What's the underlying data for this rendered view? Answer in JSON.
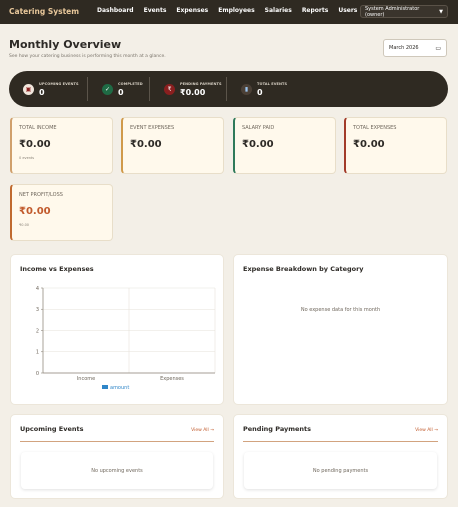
{
  "app": {
    "brand": "Catering System"
  },
  "nav": {
    "links": [
      "Dashboard",
      "Events",
      "Expenses",
      "Employees",
      "Salaries",
      "Reports",
      "Users"
    ],
    "role_select": "System Administrator (owner)"
  },
  "header": {
    "title": "Monthly Overview",
    "subtitle": "See how your catering business is performing this month at a glance.",
    "month": "March 2026"
  },
  "stats": [
    {
      "label": "UPCOMING EVENTS",
      "value": "0",
      "icon": "calendar-icon",
      "color": "#f1e6dc"
    },
    {
      "label": "COMPLETED",
      "value": "0",
      "icon": "check-icon",
      "color": "#1f6b45"
    },
    {
      "label": "PENDING PAYMENTS",
      "value": "₹0.00",
      "icon": "rupee-icon",
      "color": "#8a1f1f"
    },
    {
      "label": "TOTAL EVENTS",
      "value": "0",
      "icon": "bar-chart-icon",
      "color": "#4b4036"
    }
  ],
  "cards": [
    {
      "label": "TOTAL INCOME",
      "value": "₹0.00",
      "note": "0 events",
      "accent": "#d0a06c"
    },
    {
      "label": "EVENT EXPENSES",
      "value": "₹0.00",
      "note": "",
      "accent": "#d09a4a"
    },
    {
      "label": "SALARY PAID",
      "value": "₹0.00",
      "note": "",
      "accent": "#2f7a5a"
    },
    {
      "label": "TOTAL EXPENSES",
      "value": "₹0.00",
      "note": "",
      "accent": "#a23b2a"
    },
    {
      "label": "NET PROFIT/LOSS",
      "value": "₹0.00",
      "note": "₹0.00",
      "accent": "#c06a2f"
    }
  ],
  "income_chart": {
    "title": "Income vs Expenses",
    "legend": "amount",
    "chart_data": {
      "type": "bar",
      "categories": [
        "Income",
        "Expenses"
      ],
      "series": [
        {
          "name": "amount",
          "values": [
            0,
            0
          ]
        }
      ],
      "yticks": [
        "0",
        "1",
        "2",
        "3",
        "4"
      ],
      "ylim": [
        0,
        4
      ],
      "grid": true,
      "legend_position": "bottom"
    }
  },
  "expense_breakdown": {
    "title": "Expense Breakdown by Category",
    "empty": "No expense data for this month"
  },
  "upcoming": {
    "title": "Upcoming Events",
    "view_all": "View All →",
    "empty": "No upcoming events"
  },
  "pending": {
    "title": "Pending Payments",
    "view_all": "View All →",
    "empty": "No pending payments"
  },
  "colors": {
    "nav_bg": "#2f2a22",
    "brand": "#e9c89b",
    "link": "#c15a2c",
    "bar": "#2f86c8"
  }
}
